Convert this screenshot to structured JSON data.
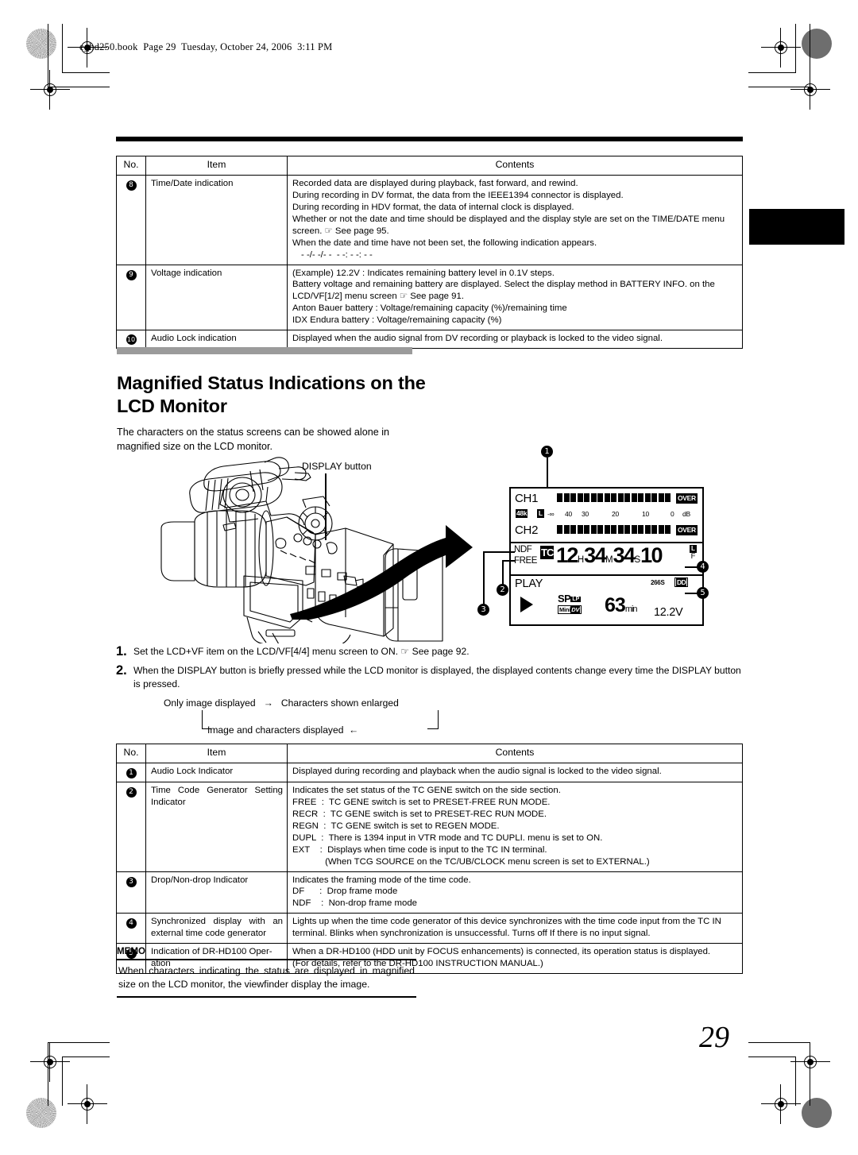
{
  "running_header": "e_hd250.book  Page 29  Tuesday, October 24, 2006  3:11 PM",
  "page_number": "29",
  "table_headers": {
    "no": "No.",
    "item": "Item",
    "contents": "Contents"
  },
  "top_table": {
    "rows": [
      {
        "no": "8",
        "item": "Time/Date indication",
        "contents": [
          "Recorded data are displayed during playback, fast forward, and rewind.",
          "During recording in DV format, the data from the IEEE1394 connector is displayed.",
          "During recording in HDV format, the data of internal clock is displayed.",
          "Whether or not the date and time should be displayed and the display style are set on the TIME/DATE menu screen. ☞ See page 95.",
          "When the date and time have not been set, the following indication appears.",
          "- -/- -/- -  - -: - -: - -"
        ]
      },
      {
        "no": "9",
        "item": "Voltage indication",
        "contents": [
          "(Example) 12.2V : Indicates remaining battery level in 0.1V steps.",
          "Battery voltage and remaining battery are displayed. Select the display method in BATTERY INFO. on the LCD/VF[1/2] menu screen ☞ See page 91.",
          "Anton Bauer battery :  Voltage/remaining capacity (%)/remaining time",
          "IDX Endura battery :  Voltage/remaining capacity (%)"
        ]
      },
      {
        "no": "10",
        "item": "Audio Lock indication",
        "contents": [
          "Displayed when the audio signal from DV recording or playback is locked to the video signal."
        ]
      }
    ]
  },
  "section": {
    "heading": "Magnified Status Indications on the LCD Monitor",
    "lead": "The characters on the status screens can be showed alone in magnified size on the LCD monitor."
  },
  "illustration": {
    "display_button_label": "DISPLAY button",
    "lcd": {
      "ch1_label": "CH1",
      "ch2_label": "CH2",
      "sampling_badge": "48k",
      "audio_lock_badge": "L",
      "over_label": "OVER",
      "scale_ticks": [
        "-∞",
        "40",
        "30",
        "20",
        "10",
        "0",
        "dB"
      ],
      "meter_segments": 17,
      "drop_mode": "NDF",
      "tc_mode": "FREE",
      "tc_badge": "TC",
      "timecode": {
        "hours": "12",
        "h_unit": "H",
        "minutes": "34",
        "m_unit": "M",
        "seconds": "34",
        "s_unit": "S",
        "frames": "10",
        "f_unit": "F"
      },
      "sync_badge": "L",
      "status": "PLAY",
      "transport_icon": "play-triangle",
      "tape_speed": "SP",
      "tape_speed_badge": "LP",
      "format_badge_prefix": "Mini",
      "format_badge": "DV",
      "remaining": "63",
      "remaining_unit": "min",
      "voltage": "12.2V",
      "dr_hd100_time": "266S",
      "dr_hd100_badge": "DD"
    },
    "callouts": [
      "1",
      "2",
      "3",
      "4",
      "5"
    ]
  },
  "steps": [
    {
      "number": "1.",
      "text": "Set the LCD+VF item on the LCD/VF[4/4] menu screen to ON.  ☞ See page 92."
    },
    {
      "number": "2.",
      "text": "When the DISPLAY button is briefly pressed while the LCD monitor is displayed, the displayed contents change every time the DISPLAY button is pressed."
    }
  ],
  "flow": {
    "left": "Only image displayed",
    "arrow": "→",
    "right": "Characters shown enlarged",
    "bottom": "Image and characters displayed",
    "bottom_arrow": "←"
  },
  "bottom_table": {
    "rows": [
      {
        "no": "1",
        "item": "Audio Lock Indicator",
        "contents": [
          "Displayed during recording and playback when the audio signal is locked to the video signal."
        ]
      },
      {
        "no": "2",
        "item": "Time Code Generator Setting Indicator",
        "contents": [
          "Indicates the set status of the TC GENE switch on the side section.",
          "FREE  :  TC GENE switch is set to PRESET-FREE RUN MODE.",
          "RECR  :  TC GENE switch is set to PRESET-REC RUN MODE.",
          "REGN  :  TC GENE switch is set to REGEN MODE.",
          "DUPL  :  There is 1394 input in VTR mode and TC DUPLI. menu is set to ON.",
          "EXT    :  Displays when time code is input to the TC IN terminal.",
          "             (When TCG SOURCE on the TC/UB/CLOCK menu screen is set to EXTERNAL.)"
        ]
      },
      {
        "no": "3",
        "item": "Drop/Non-drop Indicator",
        "contents": [
          "Indicates the framing mode of the time code.",
          "DF      :  Drop frame mode",
          "NDF    :  Non-drop frame mode"
        ]
      },
      {
        "no": "4",
        "item": "Synchronized display with an external time code generator",
        "contents": [
          "Lights up when the time code generator of this device synchronizes with the time code input from the TC IN terminal. Blinks when synchronization is unsuccessful. Turns off If there is no input signal."
        ]
      },
      {
        "no": "5",
        "item": "Indication of DR-HD100 Oper-ation",
        "contents": [
          "When a DR-HD100 (HDD unit by FOCUS enhancements) is connected, its operation status is displayed.",
          "(For details, refer to the DR-HD100 INSTRUCTION MANUAL.)"
        ]
      }
    ]
  },
  "memo": {
    "label": "MEMO",
    "text": "When characters indicating the status are displayed in magnified size on the LCD monitor, the viewfinder display the image."
  }
}
